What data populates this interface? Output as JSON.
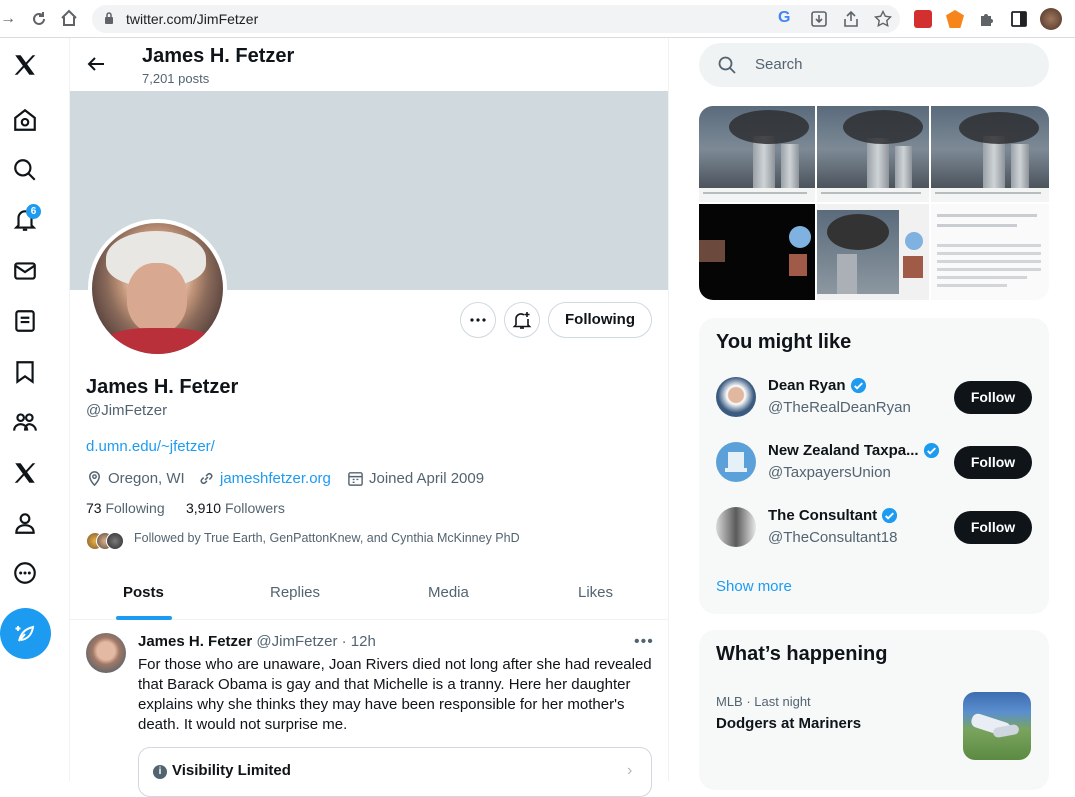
{
  "browser": {
    "url": "twitter.com/JimFetzer"
  },
  "nav": {
    "notification_count": "6"
  },
  "header": {
    "name": "James H. Fetzer",
    "posts_count": "7,201 posts"
  },
  "profile": {
    "name": "James H. Fetzer",
    "handle": "@JimFetzer",
    "bio_link": "d.umn.edu/~jfetzer/",
    "location": "Oregon, WI",
    "website": "jameshfetzer.org",
    "joined": "Joined April 2009",
    "following_count": "73",
    "following_label": "Following",
    "followers_count": "3,910",
    "followers_label": "Followers",
    "followed_by": "Followed by True Earth, GenPattonKnew, and Cynthia McKinney PhD",
    "following_button": "Following"
  },
  "tabs": [
    {
      "label": "Posts",
      "active": true
    },
    {
      "label": "Replies",
      "active": false
    },
    {
      "label": "Media",
      "active": false
    },
    {
      "label": "Likes",
      "active": false
    }
  ],
  "tweet": {
    "author": "James H. Fetzer",
    "handle_time": "@JimFetzer · 12h",
    "text": "For those who are unaware, Joan Rivers died not long after she had revealed that Barack Obama is gay and that Michelle is a tranny. Here her daughter explains why she thinks they may have been responsible for her mother's death.  It would not surprise me.",
    "visibility_label": "Visibility Limited"
  },
  "search": {
    "placeholder": "Search"
  },
  "you_might_like": {
    "title": "You might like",
    "items": [
      {
        "name": "Dean Ryan",
        "handle": "@TheRealDeanRyan",
        "button": "Follow"
      },
      {
        "name": "New Zealand Taxpa...",
        "handle": "@TaxpayersUnion",
        "button": "Follow"
      },
      {
        "name": "The Consultant",
        "handle": "@TheConsultant18",
        "button": "Follow"
      }
    ],
    "show_more": "Show more"
  },
  "whats_happening": {
    "title": "What’s happening",
    "meta": "MLB · Last night",
    "headline": "Dodgers at Mariners"
  },
  "colors": {
    "accent": "#1d9bf0",
    "text": "#0f1419",
    "muted": "#536471"
  }
}
